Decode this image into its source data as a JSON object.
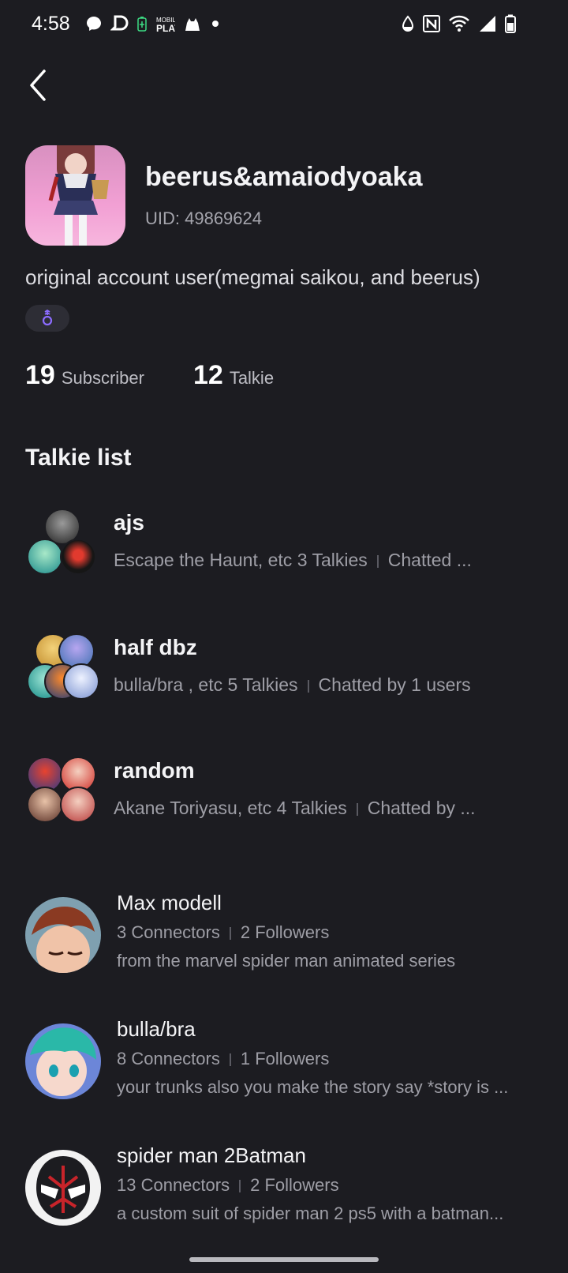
{
  "status_bar": {
    "time": "4:58",
    "left_icons": [
      "messenger-icon",
      "d-app-icon",
      "battery-saver-icon",
      "mobile-play-icon",
      "cat-icon",
      "dot-icon"
    ],
    "right_icons": [
      "data-saver-icon",
      "nfc-icon",
      "wifi-icon",
      "signal-icon",
      "battery-icon"
    ]
  },
  "nav": {
    "back_icon": "chevron-left-icon"
  },
  "profile": {
    "username": "beerus&amaiodyoaka",
    "uid": "UID: 49869624",
    "bio": "original account user(megmai saikou, and beerus)",
    "badge_icon": "gender-badge-icon",
    "subscribers_count": "19",
    "subscribers_label": "Subscriber",
    "talkie_count": "12",
    "talkie_label": "Talkie"
  },
  "talkie_list": {
    "title": "Talkie list",
    "collections": [
      {
        "name": "ajs",
        "summary": "Escape the Haunt, etc 3 Talkies",
        "chatted": "Chatted ..."
      },
      {
        "name": "half dbz",
        "summary": "bulla/bra , etc 5 Talkies",
        "chatted": "Chatted by 1 users"
      },
      {
        "name": "random",
        "summary": "Akane Toriyasu, etc 4 Talkies",
        "chatted": "Chatted by ..."
      }
    ],
    "characters": [
      {
        "name": "Max modell",
        "connectors": "3 Connectors",
        "followers": "2 Followers",
        "description": "from the marvel spider man animated series"
      },
      {
        "name": "bulla/bra",
        "connectors": "8 Connectors",
        "followers": "1 Followers",
        "description": "your trunks also you make the story say *story is ..."
      },
      {
        "name": "spider man 2Batman",
        "connectors": "13 Connectors",
        "followers": "2 Followers",
        "description": "a custom suit of spider man 2 ps5 with a batman..."
      }
    ]
  }
}
